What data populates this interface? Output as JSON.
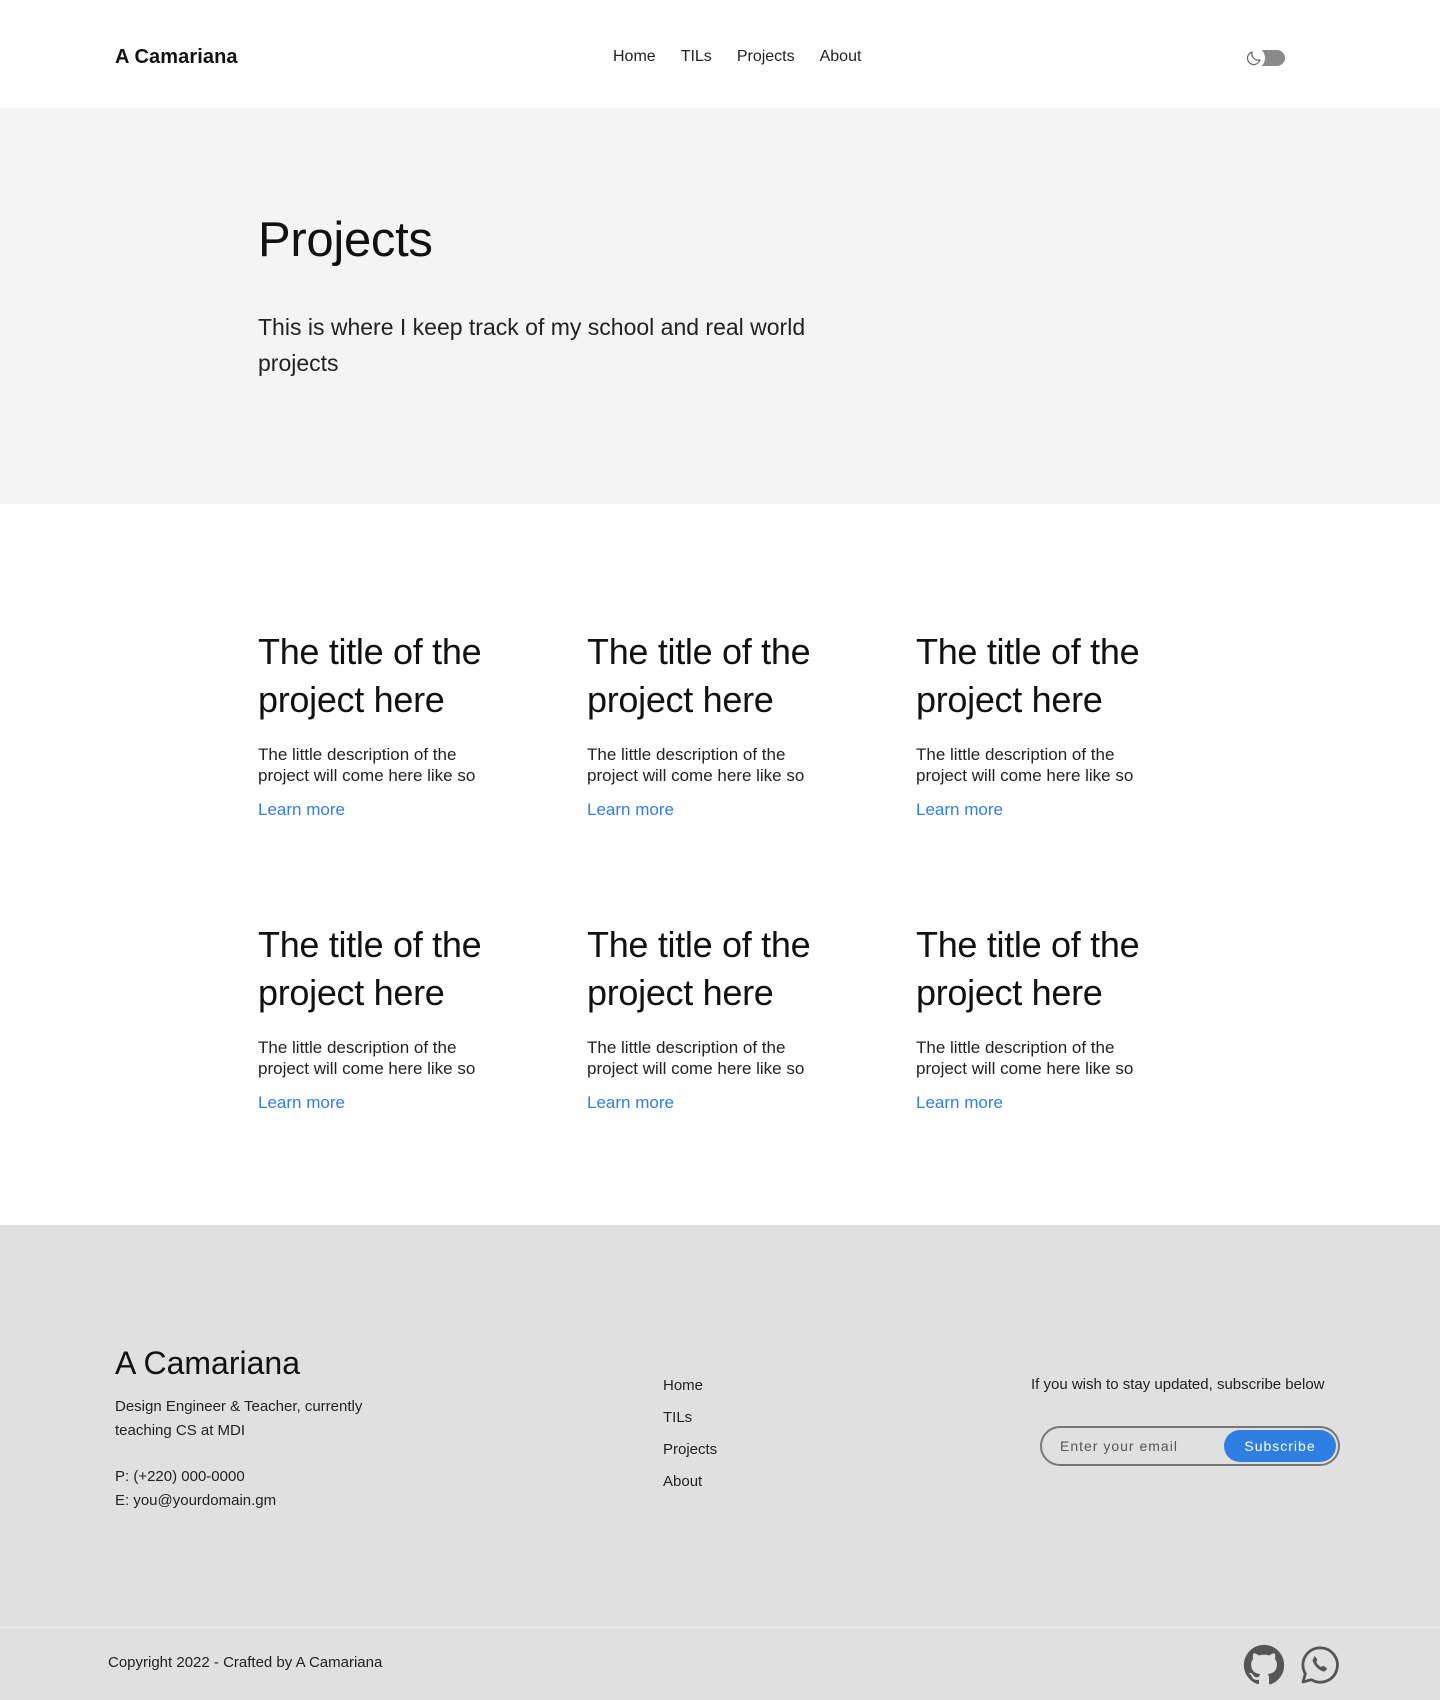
{
  "header": {
    "brand": "A Camariana",
    "nav": [
      "Home",
      "TILs",
      "Projects",
      "About"
    ],
    "theme_toggle_icon": "moon-icon"
  },
  "hero": {
    "title": "Projects",
    "subtitle": "This is where I keep track of my school and real world projects"
  },
  "projects": [
    {
      "title": "The title of the project here",
      "description": "The little description of the\nproject will  come here like so",
      "link": "Learn more"
    },
    {
      "title": "The title of the project here",
      "description": "The little description of the\nproject will  come here like so",
      "link": "Learn more"
    },
    {
      "title": "The title of the project here",
      "description": "The little description of the\nproject will  come here like so",
      "link": "Learn more"
    },
    {
      "title": "The title of the project here",
      "description": "The little description of the\nproject will  come here like so",
      "link": "Learn more"
    },
    {
      "title": "The title of the project here",
      "description": "The little description of the\nproject will  come here like so",
      "link": "Learn more"
    },
    {
      "title": "The title of the project here",
      "description": "The little description of the\nproject will  come here like so",
      "link": "Learn more"
    }
  ],
  "footer": {
    "brand": "A Camariana",
    "tagline": "Design Engineer & Teacher, currently teaching CS at MDI",
    "phone": "P: (+220) 000-0000",
    "email": "E: you@yourdomain.gm",
    "links": [
      "Home",
      "TILs",
      "Projects",
      "About"
    ],
    "subscribe_label": "If you wish to stay updated, subscribe below",
    "email_placeholder": "Enter your email",
    "subscribe_button": "Subscribe",
    "copyright": "Copyright 2022 - Crafted by A Camariana",
    "social_icons": [
      "github-icon",
      "whatsapp-icon"
    ]
  },
  "colors": {
    "accent": "#2f7fe3",
    "hero_bg": "#f4f4f4",
    "footer_bg": "#e0e0e0"
  }
}
